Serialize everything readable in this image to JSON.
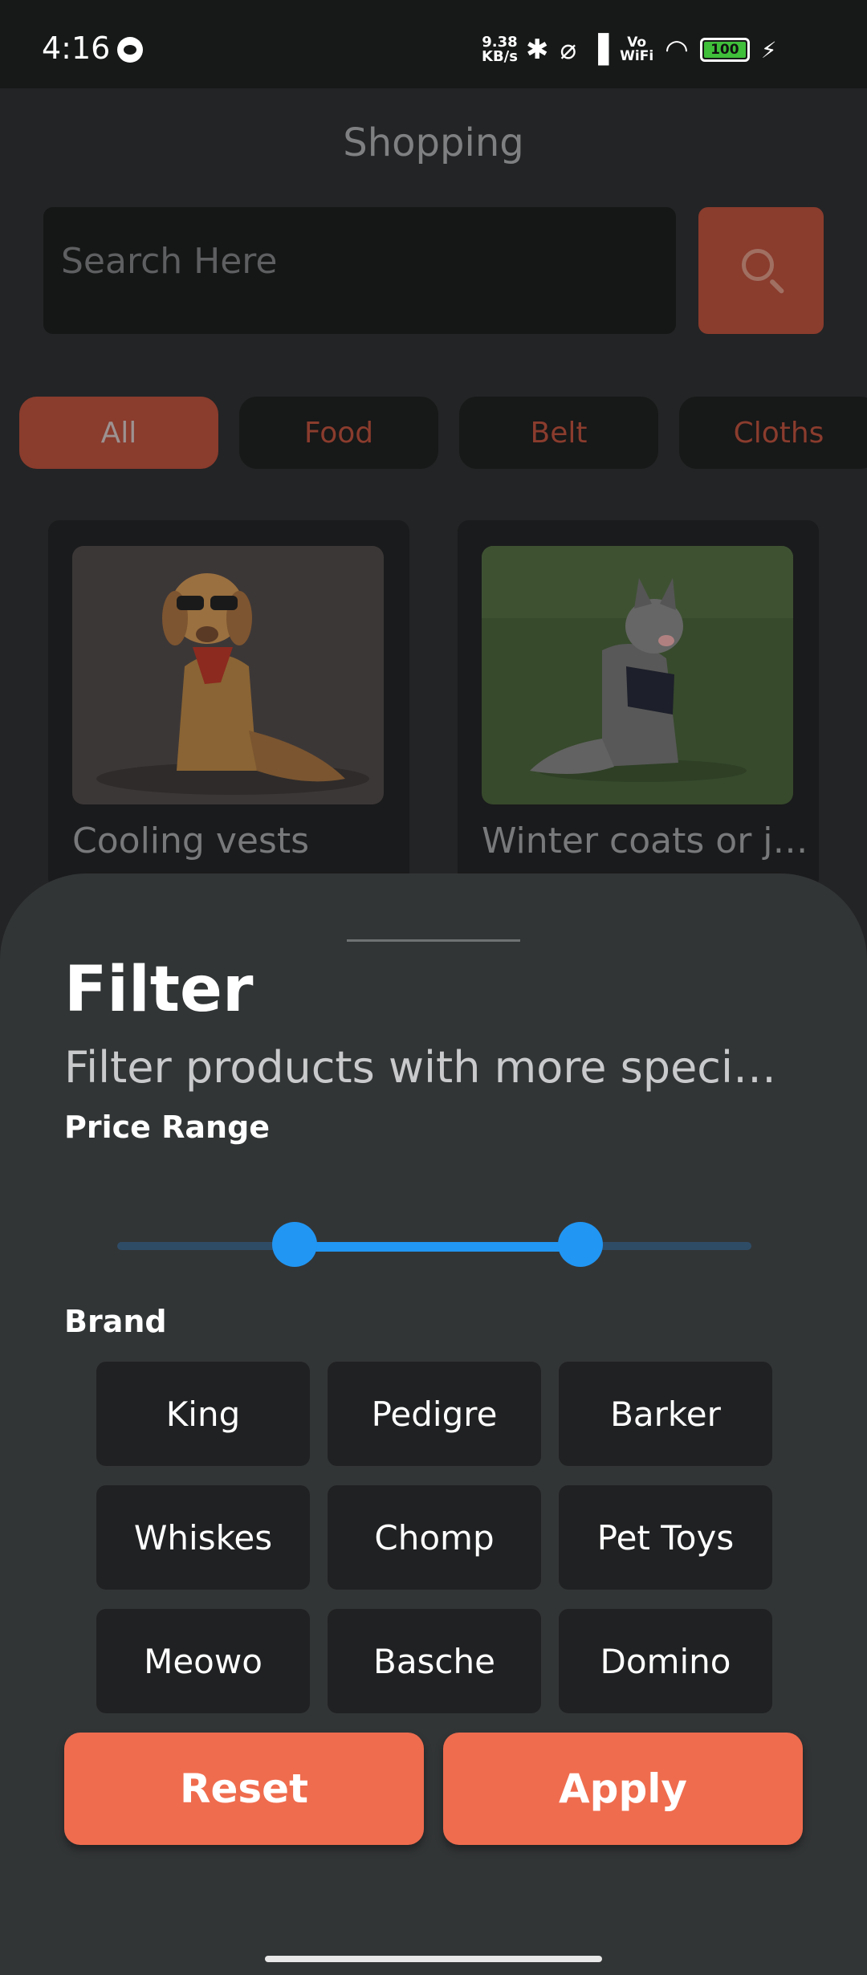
{
  "status_bar": {
    "time": "4:16",
    "speed_top": "9.38",
    "speed_bottom": "KB/s",
    "bluetooth_icon": "✱",
    "mute_icon": "⌀",
    "signal_icon": "▐",
    "vowifi_top": "Vo",
    "vowifi_bottom": "WiFi",
    "wifi_icon": "◠",
    "battery": "100",
    "charging_icon": "⚡"
  },
  "app": {
    "title": "Shopping",
    "search_placeholder": "Search Here",
    "accent_color": "#ef6c4e"
  },
  "categories": [
    {
      "label": "All",
      "active": true
    },
    {
      "label": "Food",
      "active": false
    },
    {
      "label": "Belt",
      "active": false
    },
    {
      "label": "Cloths",
      "active": false
    }
  ],
  "products": [
    {
      "name": "Cooling vests"
    },
    {
      "name": "Winter coats or jackets"
    }
  ],
  "filter": {
    "title": "Filter",
    "subtitle": "Filter products with more specific options",
    "price_label": "Price Range",
    "price_range": {
      "low_fraction": 0.28,
      "high_fraction": 0.73
    },
    "brand_label": "Brand",
    "brands": [
      "King",
      "Pedigre",
      "Barker",
      "Whiskes",
      "Chomp",
      "Pet Toys",
      "Meowo",
      "Basche",
      "Domino"
    ],
    "reset_label": "Reset",
    "apply_label": "Apply"
  }
}
